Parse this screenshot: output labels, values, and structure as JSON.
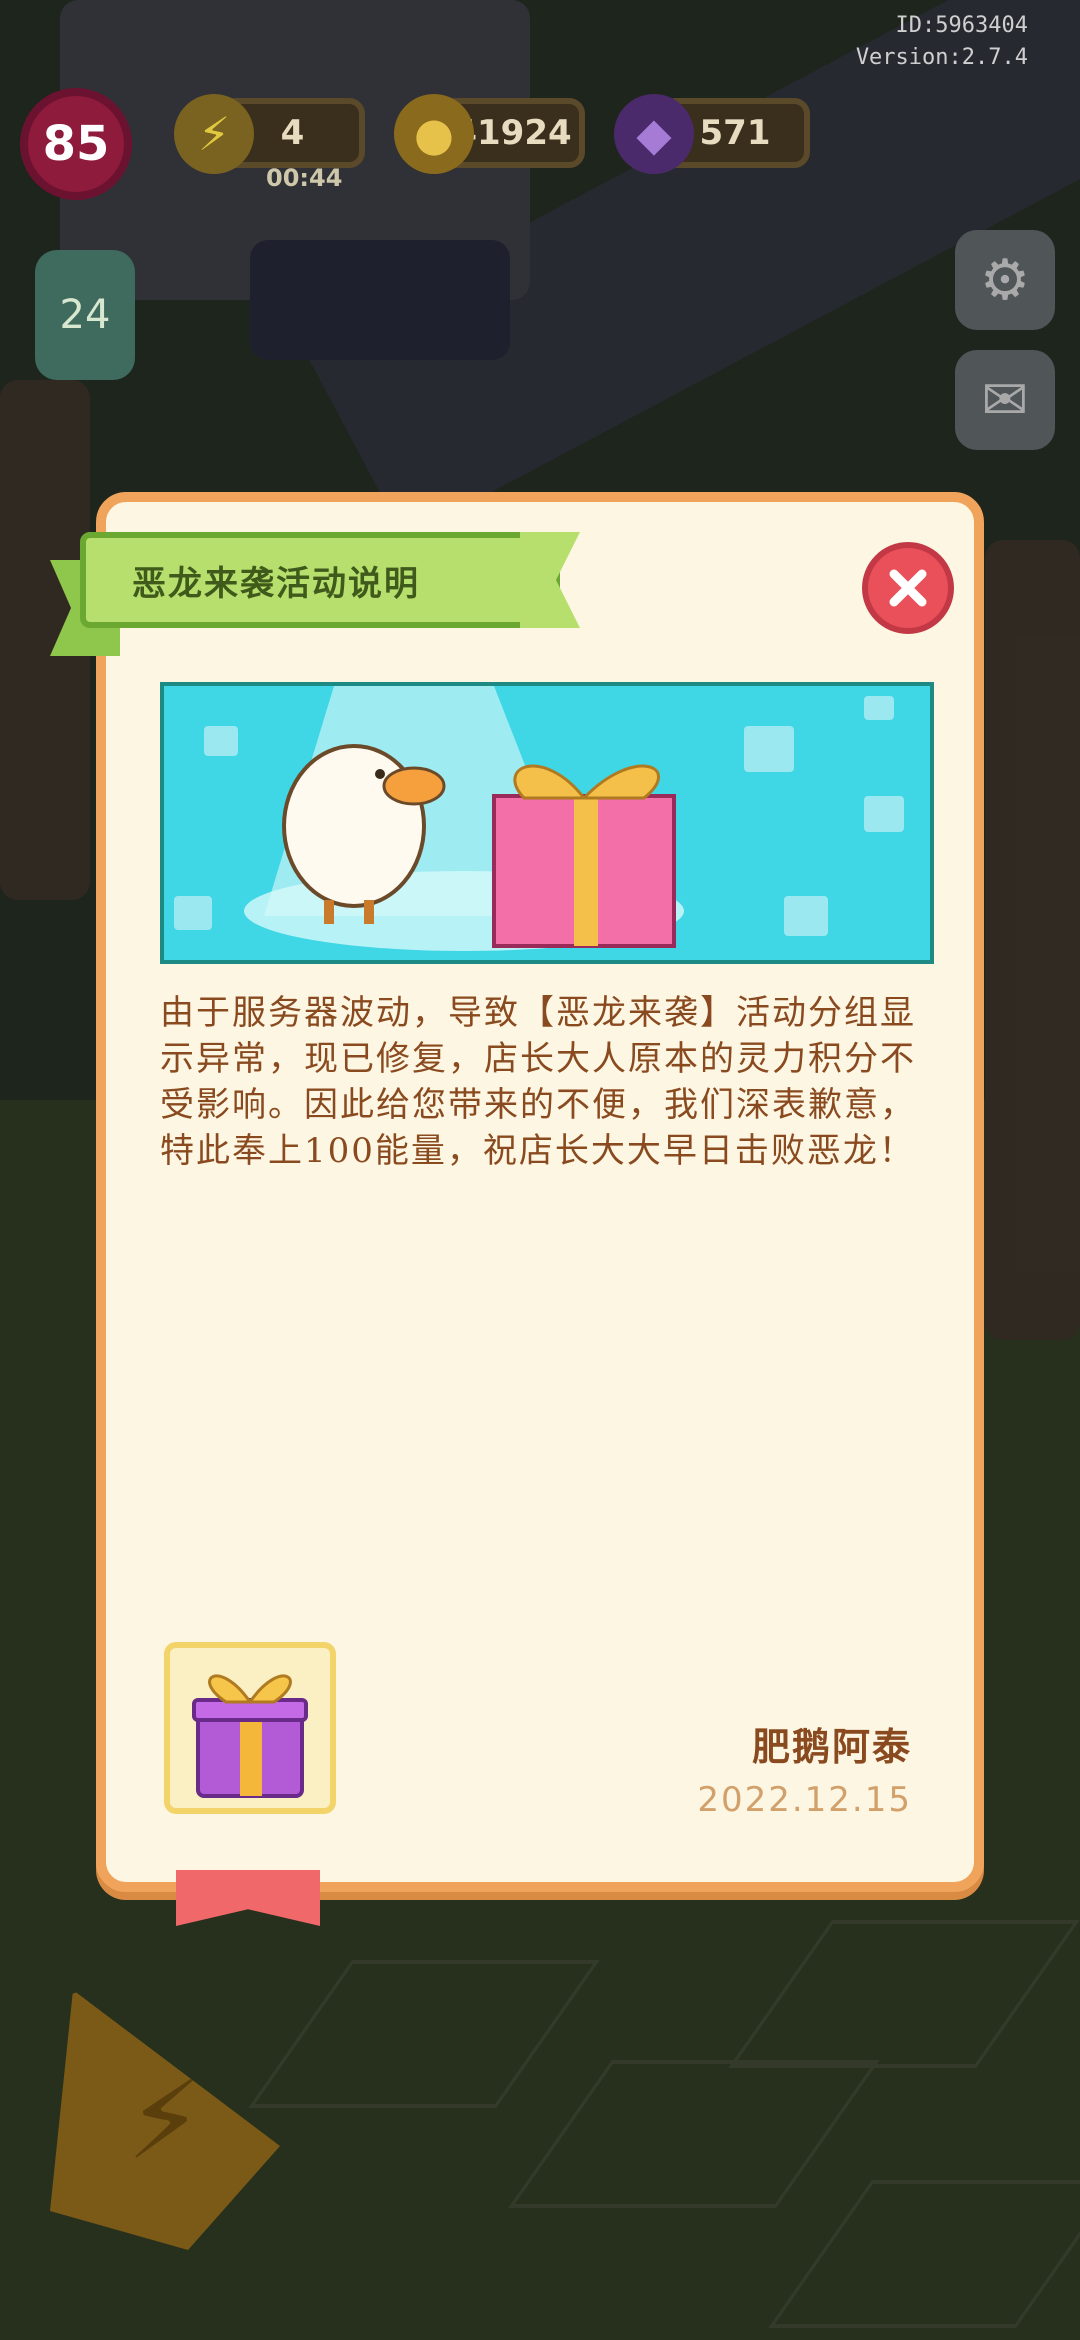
{
  "hud": {
    "player_id": "ID:5963404",
    "version": "Version:2.7.4",
    "level": "85",
    "energy": {
      "value": "4",
      "timer": "00:44"
    },
    "coins": "41924",
    "gems": "571",
    "quest_count": "24"
  },
  "dialog": {
    "title": "恶龙来袭活动说明",
    "close_icon": "close-x-icon",
    "body": "由于服务器波动，导致【恶龙来袭】活动分组显示异常，现已修复，店长大人原本的灵力积分不受影响。因此给您带来的不便，我们深表歉意，特此奉上100能量，祝店长大大早日击败恶龙！",
    "reward_icon": "gift-box-icon",
    "signature": "肥鹅阿泰",
    "date": "2022.12.15"
  },
  "colors": {
    "modal_bg": "#fdf6e3",
    "modal_border": "#f0a35a",
    "title_ribbon": "#b6df6e",
    "text_brown": "#8a4a1f",
    "close_red": "#e9505a",
    "banner_cyan": "#3fd6e6"
  }
}
